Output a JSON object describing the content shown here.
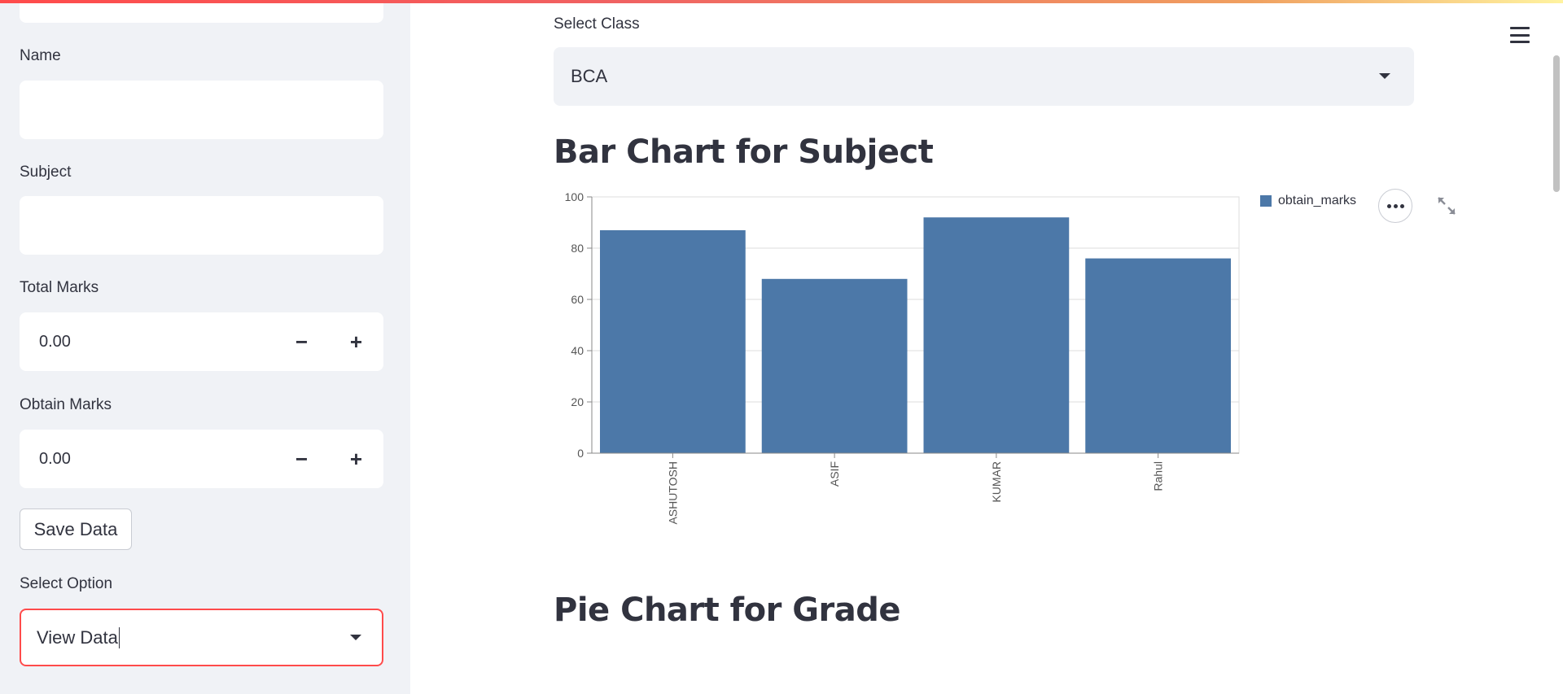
{
  "sidebar": {
    "name_label": "Name",
    "subject_label": "Subject",
    "total_marks_label": "Total Marks",
    "total_marks_value": "0.00",
    "obtain_marks_label": "Obtain Marks",
    "obtain_marks_value": "0.00",
    "minus": "−",
    "plus": "+",
    "save_label": "Save Data",
    "select_option_label": "Select Option",
    "select_option_value": "View Data"
  },
  "main": {
    "select_class_label": "Select Class",
    "select_class_value": "BCA",
    "bar_heading": "Bar Chart for Subject",
    "pie_heading": "Pie Chart for Grade"
  },
  "icons": {
    "menu": "hamburger-menu-icon",
    "more": "more-options-icon",
    "expand": "fullscreen-icon",
    "dropdown": "chevron-down-icon"
  },
  "colors": {
    "bar": "#4c78a8",
    "accent": "#ff4b4b",
    "sidebar_bg": "#f0f2f6"
  },
  "chart_data": {
    "type": "bar",
    "categories": [
      "ASHUTOSH",
      "ASIF",
      "KUMAR",
      "Rahul"
    ],
    "series": [
      {
        "name": "obtain_marks",
        "values": [
          87,
          68,
          92,
          76
        ]
      }
    ],
    "ylim": [
      0,
      100
    ],
    "yticks": [
      0,
      20,
      40,
      60,
      80,
      100
    ],
    "grid": true,
    "legend": "top-right"
  }
}
